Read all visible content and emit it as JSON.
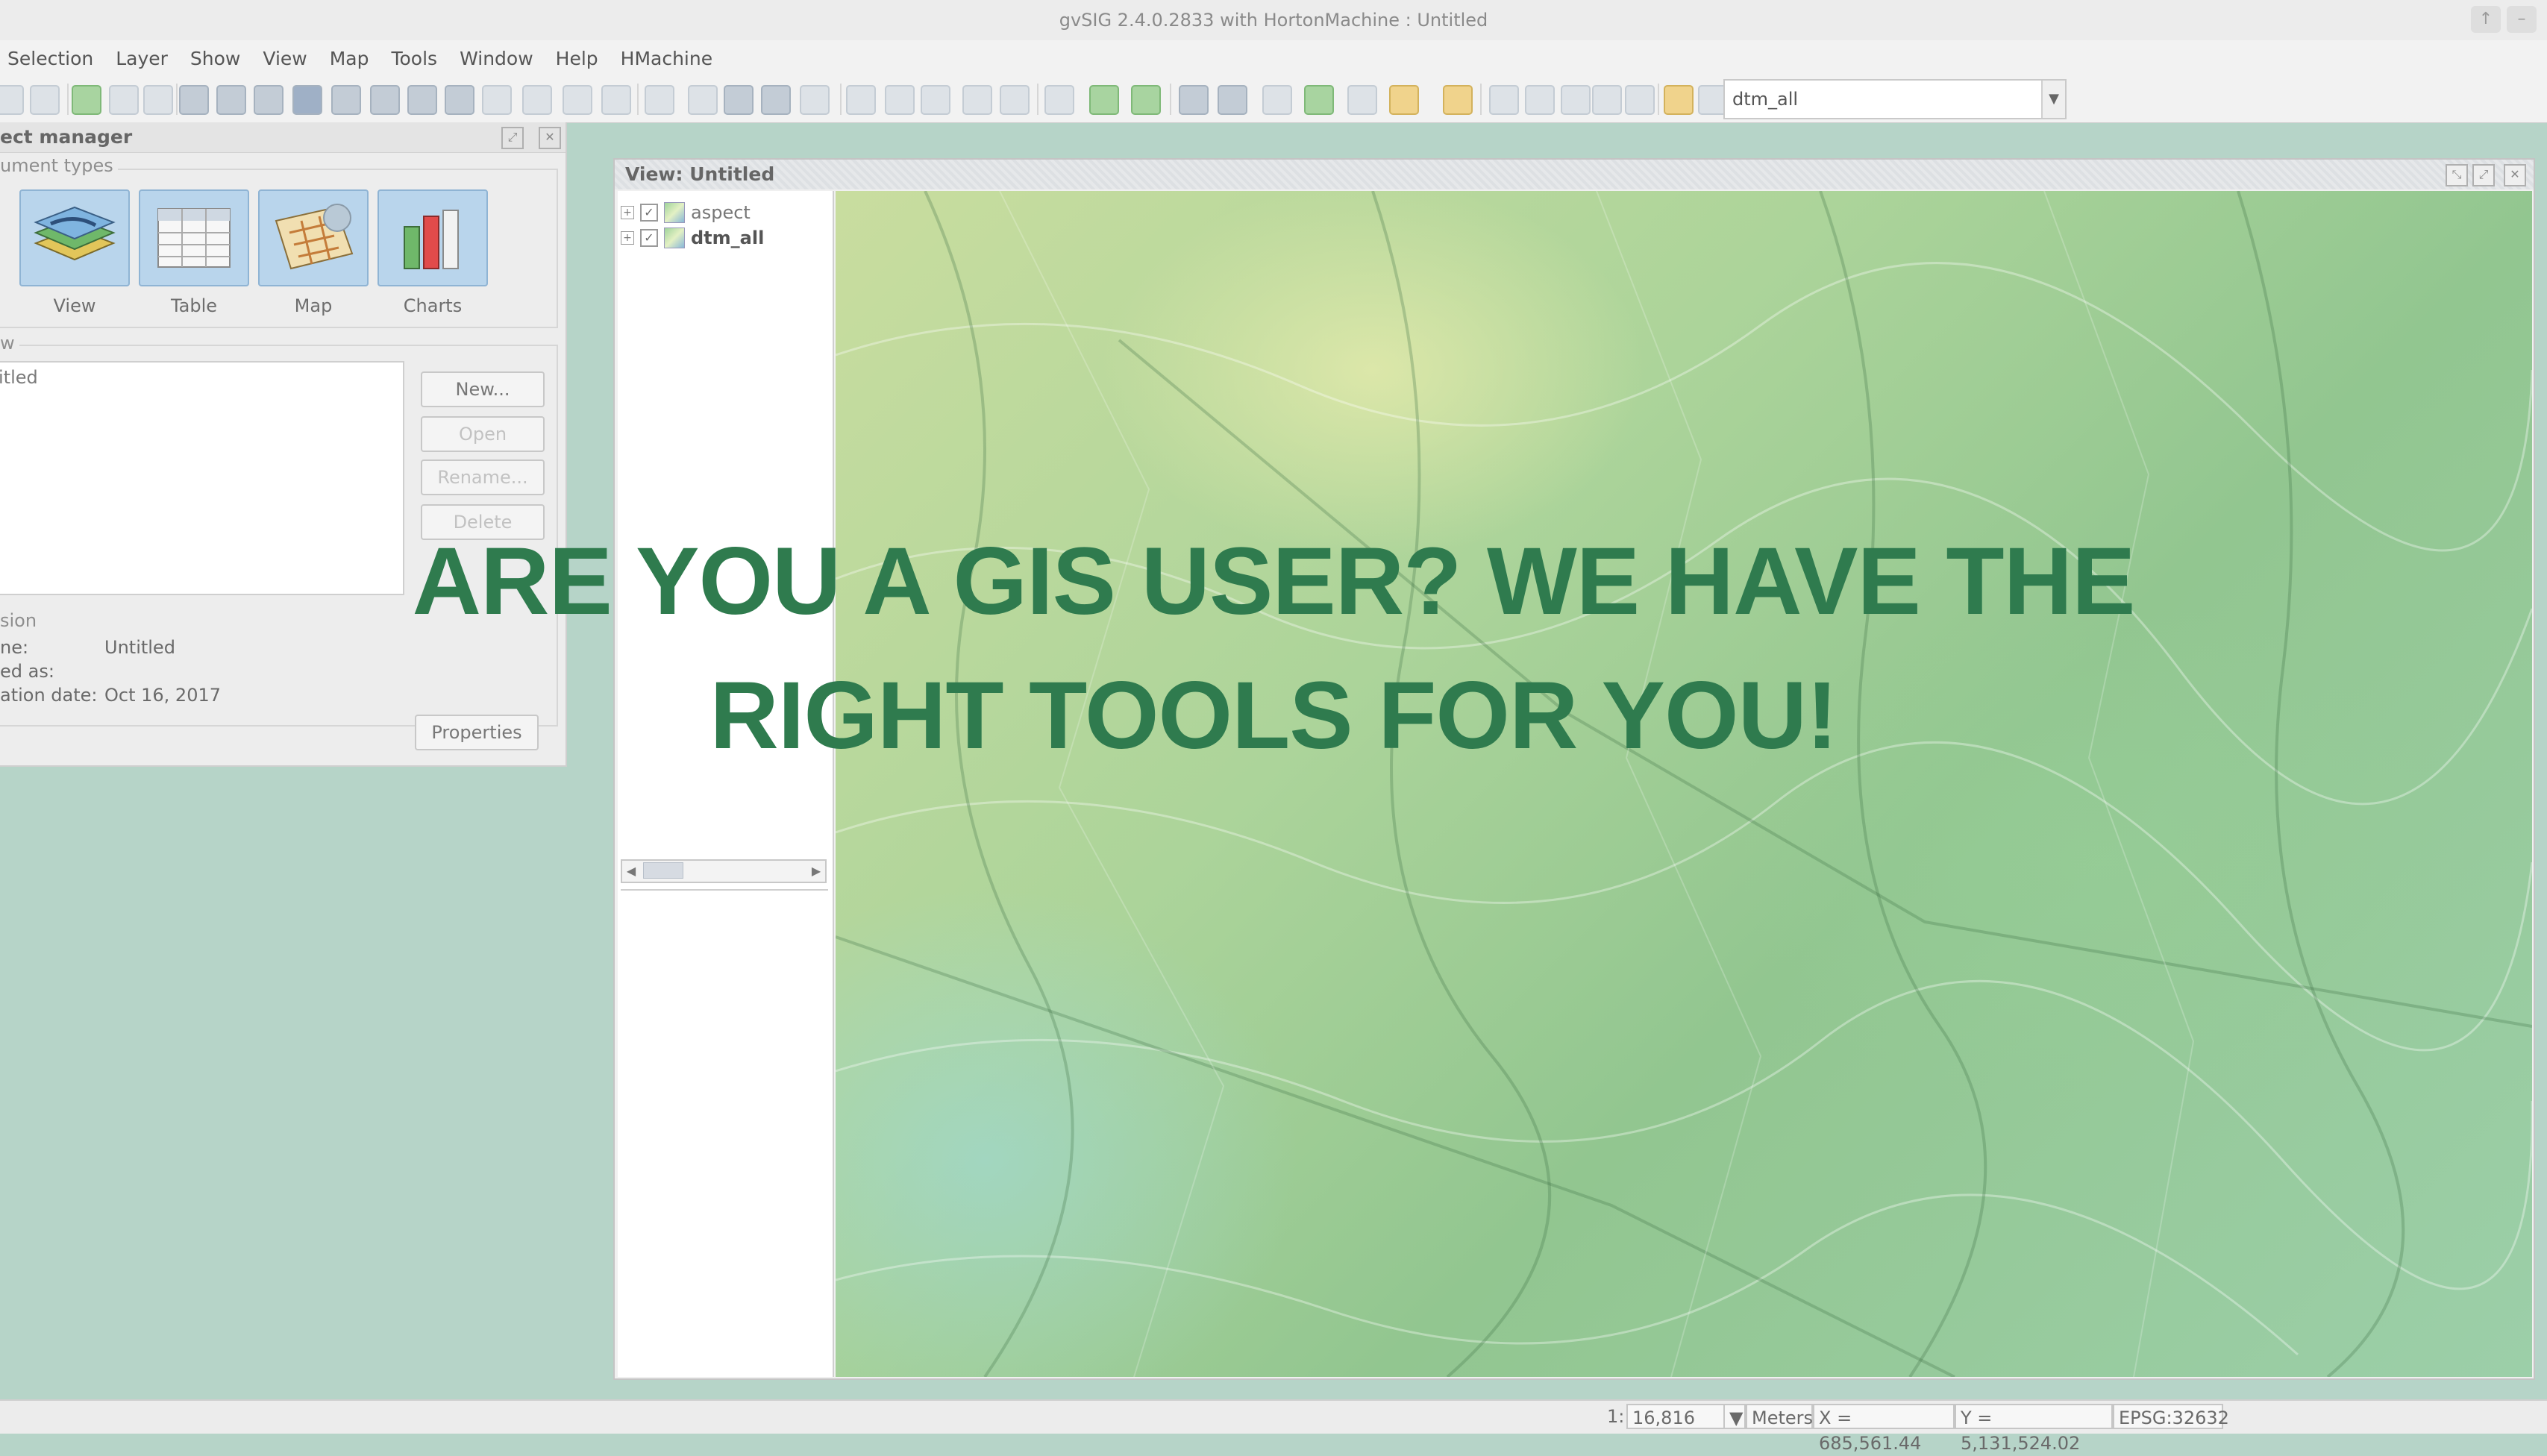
{
  "window": {
    "title": "gvSIG 2.4.0.2833 with HortonMachine : Untitled",
    "controls": [
      "↑",
      "–"
    ]
  },
  "menu": [
    "Selection",
    "Layer",
    "Show",
    "View",
    "Map",
    "Tools",
    "Window",
    "Help",
    "HMachine"
  ],
  "toolbar": {
    "layer_combo_value": "dtm_all"
  },
  "project_manager": {
    "title": "ect manager",
    "doc_types_label": "ument types",
    "doc_types": [
      "View",
      "Table",
      "Map",
      "Charts"
    ],
    "list_label": "w",
    "list_items": [
      "itled"
    ],
    "buttons": {
      "new": "New...",
      "open": "Open",
      "rename": "Rename...",
      "delete": "Delete"
    },
    "session_label": "sion",
    "session_fields": [
      {
        "key": "ne:",
        "value": "Untitled"
      },
      {
        "key": "ed as:",
        "value": ""
      },
      {
        "key": "ation date:",
        "value": "Oct 16, 2017"
      }
    ],
    "properties_button": "Properties"
  },
  "view_window": {
    "title": "View: Untitled",
    "layers": [
      {
        "name": "aspect",
        "bold": false,
        "checked": true
      },
      {
        "name": "dtm_all",
        "bold": true,
        "checked": true
      }
    ]
  },
  "status": {
    "scale_prefix": "1:",
    "scale_value": "16,816",
    "units": "Meters",
    "x": "X = 685,561.44",
    "y": "Y = 5,131,524.02",
    "epsg": "EPSG:32632"
  },
  "promo": {
    "line1": "ARE YOU A GIS USER? WE HAVE THE",
    "line2": "RIGHT TOOLS FOR YOU!"
  }
}
